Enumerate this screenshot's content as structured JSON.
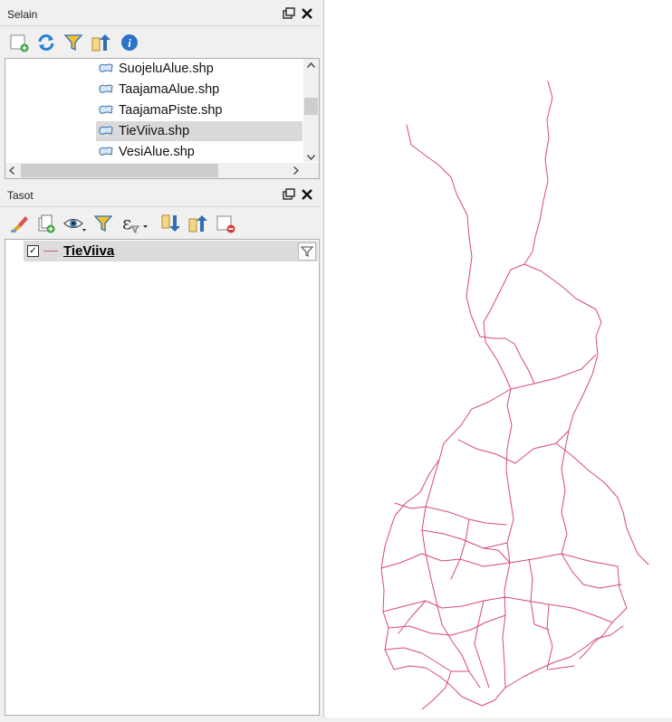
{
  "browser_panel": {
    "title": "Selain",
    "items": [
      {
        "label": "SuojeluAlue.shp",
        "selected": false
      },
      {
        "label": "TaajamaAlue.shp",
        "selected": false
      },
      {
        "label": "TaajamaPiste.shp",
        "selected": false
      },
      {
        "label": "TieViiva.shp",
        "selected": true
      },
      {
        "label": "VesiAlue.shp",
        "selected": false
      }
    ],
    "toolbar_icons": [
      "add-layer-icon",
      "refresh-icon",
      "filter-icon",
      "collapse-all-icon",
      "info-icon"
    ]
  },
  "layers_panel": {
    "title": "Tasot",
    "toolbar_icons": [
      "style-brush-icon",
      "add-group-icon",
      "visibility-eye-icon",
      "filter-icon",
      "expression-filter-icon",
      "expand-all-icon",
      "collapse-all-icon",
      "remove-layer-icon"
    ],
    "layers": [
      {
        "name": "TieViiva",
        "checked": true,
        "symbol_color": "#c65b8a"
      }
    ]
  },
  "map": {
    "road_color": "#d64a77",
    "background": "#ffffff"
  }
}
